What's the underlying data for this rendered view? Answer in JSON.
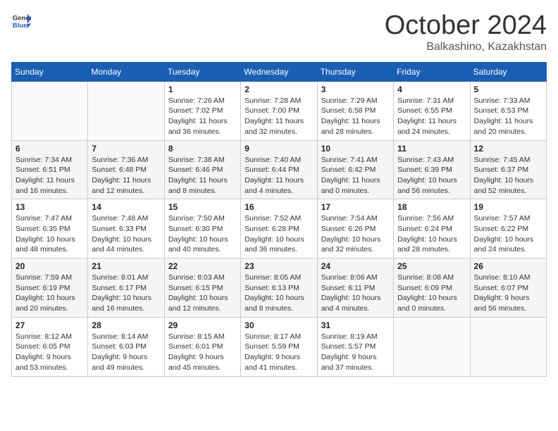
{
  "logo": {
    "general": "General",
    "blue": "Blue"
  },
  "title": {
    "month": "October 2024",
    "location": "Balkashino, Kazakhstan"
  },
  "days_of_week": [
    "Sunday",
    "Monday",
    "Tuesday",
    "Wednesday",
    "Thursday",
    "Friday",
    "Saturday"
  ],
  "weeks": [
    [
      {
        "day": "",
        "sunrise": "",
        "sunset": "",
        "daylight": ""
      },
      {
        "day": "",
        "sunrise": "",
        "sunset": "",
        "daylight": ""
      },
      {
        "day": "1",
        "sunrise": "Sunrise: 7:26 AM",
        "sunset": "Sunset: 7:02 PM",
        "daylight": "Daylight: 11 hours and 36 minutes."
      },
      {
        "day": "2",
        "sunrise": "Sunrise: 7:28 AM",
        "sunset": "Sunset: 7:00 PM",
        "daylight": "Daylight: 11 hours and 32 minutes."
      },
      {
        "day": "3",
        "sunrise": "Sunrise: 7:29 AM",
        "sunset": "Sunset: 6:58 PM",
        "daylight": "Daylight: 11 hours and 28 minutes."
      },
      {
        "day": "4",
        "sunrise": "Sunrise: 7:31 AM",
        "sunset": "Sunset: 6:55 PM",
        "daylight": "Daylight: 11 hours and 24 minutes."
      },
      {
        "day": "5",
        "sunrise": "Sunrise: 7:33 AM",
        "sunset": "Sunset: 6:53 PM",
        "daylight": "Daylight: 11 hours and 20 minutes."
      }
    ],
    [
      {
        "day": "6",
        "sunrise": "Sunrise: 7:34 AM",
        "sunset": "Sunset: 6:51 PM",
        "daylight": "Daylight: 11 hours and 16 minutes."
      },
      {
        "day": "7",
        "sunrise": "Sunrise: 7:36 AM",
        "sunset": "Sunset: 6:48 PM",
        "daylight": "Daylight: 11 hours and 12 minutes."
      },
      {
        "day": "8",
        "sunrise": "Sunrise: 7:38 AM",
        "sunset": "Sunset: 6:46 PM",
        "daylight": "Daylight: 11 hours and 8 minutes."
      },
      {
        "day": "9",
        "sunrise": "Sunrise: 7:40 AM",
        "sunset": "Sunset: 6:44 PM",
        "daylight": "Daylight: 11 hours and 4 minutes."
      },
      {
        "day": "10",
        "sunrise": "Sunrise: 7:41 AM",
        "sunset": "Sunset: 6:42 PM",
        "daylight": "Daylight: 11 hours and 0 minutes."
      },
      {
        "day": "11",
        "sunrise": "Sunrise: 7:43 AM",
        "sunset": "Sunset: 6:39 PM",
        "daylight": "Daylight: 10 hours and 56 minutes."
      },
      {
        "day": "12",
        "sunrise": "Sunrise: 7:45 AM",
        "sunset": "Sunset: 6:37 PM",
        "daylight": "Daylight: 10 hours and 52 minutes."
      }
    ],
    [
      {
        "day": "13",
        "sunrise": "Sunrise: 7:47 AM",
        "sunset": "Sunset: 6:35 PM",
        "daylight": "Daylight: 10 hours and 48 minutes."
      },
      {
        "day": "14",
        "sunrise": "Sunrise: 7:48 AM",
        "sunset": "Sunset: 6:33 PM",
        "daylight": "Daylight: 10 hours and 44 minutes."
      },
      {
        "day": "15",
        "sunrise": "Sunrise: 7:50 AM",
        "sunset": "Sunset: 6:30 PM",
        "daylight": "Daylight: 10 hours and 40 minutes."
      },
      {
        "day": "16",
        "sunrise": "Sunrise: 7:52 AM",
        "sunset": "Sunset: 6:28 PM",
        "daylight": "Daylight: 10 hours and 36 minutes."
      },
      {
        "day": "17",
        "sunrise": "Sunrise: 7:54 AM",
        "sunset": "Sunset: 6:26 PM",
        "daylight": "Daylight: 10 hours and 32 minutes."
      },
      {
        "day": "18",
        "sunrise": "Sunrise: 7:56 AM",
        "sunset": "Sunset: 6:24 PM",
        "daylight": "Daylight: 10 hours and 28 minutes."
      },
      {
        "day": "19",
        "sunrise": "Sunrise: 7:57 AM",
        "sunset": "Sunset: 6:22 PM",
        "daylight": "Daylight: 10 hours and 24 minutes."
      }
    ],
    [
      {
        "day": "20",
        "sunrise": "Sunrise: 7:59 AM",
        "sunset": "Sunset: 6:19 PM",
        "daylight": "Daylight: 10 hours and 20 minutes."
      },
      {
        "day": "21",
        "sunrise": "Sunrise: 8:01 AM",
        "sunset": "Sunset: 6:17 PM",
        "daylight": "Daylight: 10 hours and 16 minutes."
      },
      {
        "day": "22",
        "sunrise": "Sunrise: 8:03 AM",
        "sunset": "Sunset: 6:15 PM",
        "daylight": "Daylight: 10 hours and 12 minutes."
      },
      {
        "day": "23",
        "sunrise": "Sunrise: 8:05 AM",
        "sunset": "Sunset: 6:13 PM",
        "daylight": "Daylight: 10 hours and 8 minutes."
      },
      {
        "day": "24",
        "sunrise": "Sunrise: 8:06 AM",
        "sunset": "Sunset: 6:11 PM",
        "daylight": "Daylight: 10 hours and 4 minutes."
      },
      {
        "day": "25",
        "sunrise": "Sunrise: 8:08 AM",
        "sunset": "Sunset: 6:09 PM",
        "daylight": "Daylight: 10 hours and 0 minutes."
      },
      {
        "day": "26",
        "sunrise": "Sunrise: 8:10 AM",
        "sunset": "Sunset: 6:07 PM",
        "daylight": "Daylight: 9 hours and 56 minutes."
      }
    ],
    [
      {
        "day": "27",
        "sunrise": "Sunrise: 8:12 AM",
        "sunset": "Sunset: 6:05 PM",
        "daylight": "Daylight: 9 hours and 53 minutes."
      },
      {
        "day": "28",
        "sunrise": "Sunrise: 8:14 AM",
        "sunset": "Sunset: 6:03 PM",
        "daylight": "Daylight: 9 hours and 49 minutes."
      },
      {
        "day": "29",
        "sunrise": "Sunrise: 8:15 AM",
        "sunset": "Sunset: 6:01 PM",
        "daylight": "Daylight: 9 hours and 45 minutes."
      },
      {
        "day": "30",
        "sunrise": "Sunrise: 8:17 AM",
        "sunset": "Sunset: 5:59 PM",
        "daylight": "Daylight: 9 hours and 41 minutes."
      },
      {
        "day": "31",
        "sunrise": "Sunrise: 8:19 AM",
        "sunset": "Sunset: 5:57 PM",
        "daylight": "Daylight: 9 hours and 37 minutes."
      },
      {
        "day": "",
        "sunrise": "",
        "sunset": "",
        "daylight": ""
      },
      {
        "day": "",
        "sunrise": "",
        "sunset": "",
        "daylight": ""
      }
    ]
  ]
}
